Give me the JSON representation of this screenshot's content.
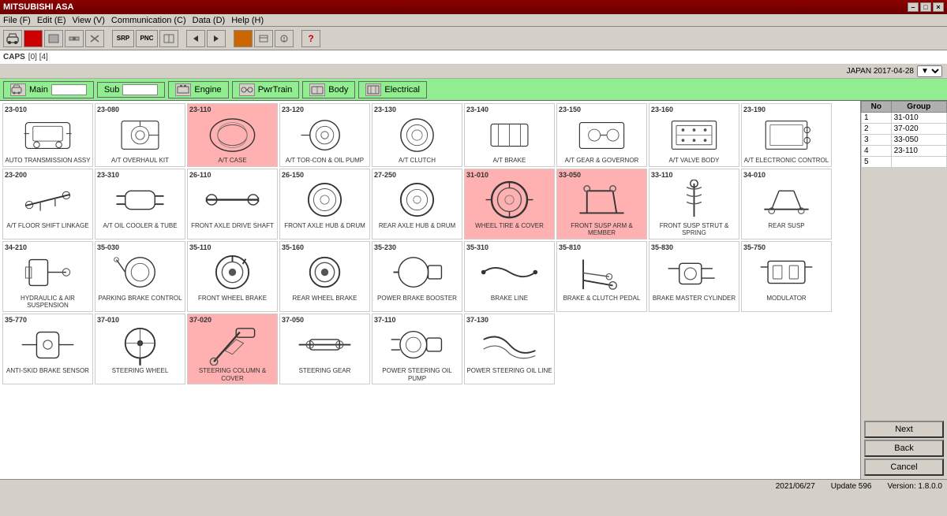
{
  "titlebar": {
    "title": "MITSUBISHI ASA",
    "controls": [
      "-",
      "□",
      "×"
    ]
  },
  "menubar": {
    "items": [
      "File (F)",
      "Edit (E)",
      "View (V)",
      "Communication (C)",
      "Data (D)",
      "Help (H)"
    ]
  },
  "toolbar": {
    "buttons": [
      "car",
      "red1",
      "gray1",
      "gray2",
      "gray3",
      "SRP",
      "PNC",
      "gray4",
      "prev",
      "next",
      "orange",
      "gray5",
      "gray6",
      "?"
    ]
  },
  "caps": {
    "label": "CAPS",
    "ref": "[0] [4]"
  },
  "info": {
    "country_date": "JAPAN  2017-04-28"
  },
  "nav": {
    "tabs": [
      {
        "id": "main",
        "label": "Main",
        "has_input": true
      },
      {
        "id": "sub",
        "label": "Sub",
        "has_input": true
      },
      {
        "id": "engine",
        "label": "Engine"
      },
      {
        "id": "pwrtrain",
        "label": "PwrTrain"
      },
      {
        "id": "body",
        "label": "Body"
      },
      {
        "id": "electrical",
        "label": "Electrical"
      }
    ]
  },
  "parts": {
    "rows": [
      [
        {
          "code": "23-010",
          "name": "AUTO TRANSMISSION ASSY",
          "highlighted": false
        },
        {
          "code": "23-080",
          "name": "A/T OVERHAUL KIT",
          "highlighted": false
        },
        {
          "code": "23-110",
          "name": "A/T CASE",
          "highlighted": true
        },
        {
          "code": "23-120",
          "name": "A/T TOR-CON & OIL PUMP",
          "highlighted": false
        },
        {
          "code": "23-130",
          "name": "A/T CLUTCH",
          "highlighted": false
        },
        {
          "code": "23-140",
          "name": "A/T BRAKE",
          "highlighted": false
        },
        {
          "code": "23-150",
          "name": "A/T GEAR & GOVERNOR",
          "highlighted": false
        },
        {
          "code": "23-160",
          "name": "A/T VALVE BODY",
          "highlighted": false
        },
        {
          "code": "23-190",
          "name": "A/T ELECTRONIC CONTROL",
          "highlighted": false
        }
      ],
      [
        {
          "code": "23-200",
          "name": "A/T FLOOR SHIFT LINKAGE",
          "highlighted": false
        },
        {
          "code": "23-310",
          "name": "A/T OIL COOLER & TUBE",
          "highlighted": false
        },
        {
          "code": "26-110",
          "name": "FRONT AXLE DRIVE SHAFT",
          "highlighted": false
        },
        {
          "code": "26-150",
          "name": "FRONT AXLE HUB & DRUM",
          "highlighted": false
        },
        {
          "code": "27-250",
          "name": "REAR AXLE HUB & DRUM",
          "highlighted": false
        },
        {
          "code": "31-010",
          "name": "WHEEL TIRE & COVER",
          "highlighted": true
        },
        {
          "code": "33-050",
          "name": "FRONT SUSP ARM & MEMBER",
          "highlighted": true
        },
        {
          "code": "33-110",
          "name": "FRONT SUSP STRUT & SPRING",
          "highlighted": false
        },
        {
          "code": "34-010",
          "name": "REAR SUSP",
          "highlighted": false
        }
      ],
      [
        {
          "code": "34-210",
          "name": "HYDRAULIC & AIR SUSPENSION",
          "highlighted": false
        },
        {
          "code": "35-030",
          "name": "PARKING BRAKE CONTROL",
          "highlighted": false
        },
        {
          "code": "35-110",
          "name": "FRONT WHEEL BRAKE",
          "highlighted": false
        },
        {
          "code": "35-160",
          "name": "REAR WHEEL BRAKE",
          "highlighted": false
        },
        {
          "code": "35-230",
          "name": "POWER BRAKE BOOSTER",
          "highlighted": false
        },
        {
          "code": "35-310",
          "name": "BRAKE LINE",
          "highlighted": false
        },
        {
          "code": "35-810",
          "name": "BRAKE & CLUTCH PEDAL",
          "highlighted": false
        },
        {
          "code": "35-830",
          "name": "BRAKE MASTER CYLINDER",
          "highlighted": false
        },
        {
          "code": "35-750",
          "name": "MODULATOR",
          "highlighted": false
        }
      ],
      [
        {
          "code": "35-770",
          "name": "ANTI-SKID BRAKE SENSOR",
          "highlighted": false
        },
        {
          "code": "37-010",
          "name": "STEERING WHEEL",
          "highlighted": false
        },
        {
          "code": "37-020",
          "name": "STEERING COLUMN & COVER",
          "highlighted": true
        },
        {
          "code": "37-050",
          "name": "STEERING GEAR",
          "highlighted": false
        },
        {
          "code": "37-110",
          "name": "POWER STEERING OIL PUMP",
          "highlighted": false
        },
        {
          "code": "37-130",
          "name": "POWER STEERING OIL LINE",
          "highlighted": false
        }
      ]
    ]
  },
  "group_table": {
    "headers": [
      "No",
      "Group"
    ],
    "rows": [
      {
        "no": "1",
        "group": "31-010"
      },
      {
        "no": "2",
        "group": "37-020"
      },
      {
        "no": "3",
        "group": "33-050"
      },
      {
        "no": "4",
        "group": "23-110"
      },
      {
        "no": "5",
        "group": ""
      }
    ]
  },
  "buttons": {
    "next": "Next",
    "back": "Back",
    "cancel": "Cancel"
  },
  "statusbar": {
    "date": "2021/06/27",
    "update": "Update 596",
    "version": "Version: 1.8.0.0"
  }
}
